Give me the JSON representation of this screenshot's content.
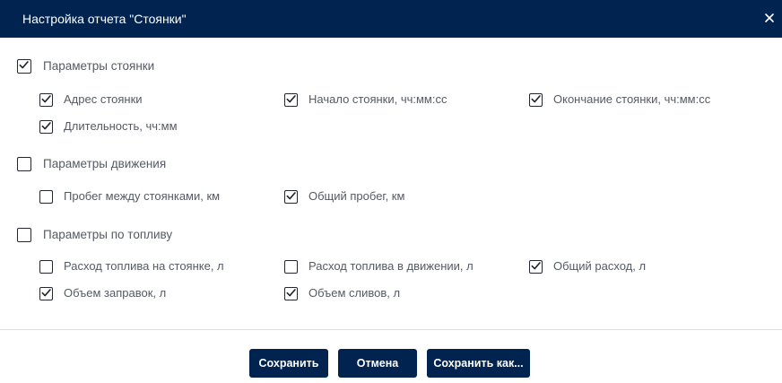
{
  "dialog": {
    "title": "Настройка отчета \"Стоянки\"",
    "close_icon": "close-icon"
  },
  "groups": [
    {
      "label": "Параметры стоянки",
      "checked": true,
      "items": [
        {
          "label": "Адрес стоянки",
          "checked": true
        },
        {
          "label": "Начало стоянки, чч:мм:сс",
          "checked": true
        },
        {
          "label": "Окончание стоянки, чч:мм:сс",
          "checked": true
        },
        {
          "label": "Длительность, чч:мм",
          "checked": true
        }
      ]
    },
    {
      "label": "Параметры движения",
      "checked": false,
      "items": [
        {
          "label": "Пробег между стоянками, км",
          "checked": false
        },
        {
          "label": "Общий пробег, км",
          "checked": true
        }
      ]
    },
    {
      "label": "Параметры по топливу",
      "checked": false,
      "items": [
        {
          "label": "Расход топлива на стоянке, л",
          "checked": false
        },
        {
          "label": "Расход топлива в движении, л",
          "checked": false
        },
        {
          "label": "Общий расход, л",
          "checked": true
        },
        {
          "label": "Объем заправок, л",
          "checked": true
        },
        {
          "label": "Объем сливов, л",
          "checked": true
        }
      ]
    }
  ],
  "buttons": {
    "save": "Сохранить",
    "cancel": "Отмена",
    "save_as": "Сохранить как..."
  },
  "colors": {
    "header_bg": "#002350",
    "button_bg": "#002350",
    "label_text": "#555a63"
  }
}
